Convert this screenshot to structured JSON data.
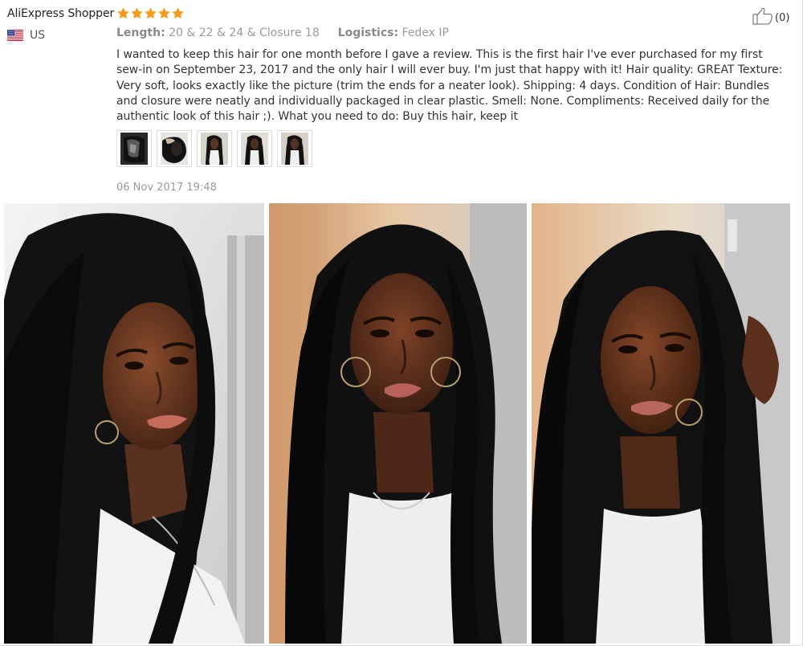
{
  "reviewer": {
    "name": "AliExpress Shopper",
    "country_code": "US",
    "flag_icon": "us-flag-icon"
  },
  "rating": {
    "stars": 5,
    "max": 5,
    "color": "#f49b1d"
  },
  "attributes": {
    "length_label": "Length:",
    "length_value": "20 & 22 & 24 & Closure 18",
    "logistics_label": "Logistics:",
    "logistics_value": "Fedex IP"
  },
  "body": "I wanted to keep this hair for one month before I gave a review. This is the first hair I've ever purchased for my first sew-in on September 23, 2017 and the only hair I will ever buy. I'm just that happy with it! Hair quality: GREAT Texture: Very soft, looks exactly like the picture (trim the ends for a neater look). Shipping: 4 days. Condition of Hair: Bundles and closure were neatly and individually packaged in clear plastic. Smell: None. Compliments: Received daily for the authentic look of this hair ;). What you need to do: Buy this hair, keep it",
  "thumbnails": [
    {
      "name": "review-thumbnail-1",
      "content": "hair-bundle-photo"
    },
    {
      "name": "review-thumbnail-2",
      "content": "hair-closure-photo"
    },
    {
      "name": "review-thumbnail-3",
      "content": "wearer-photo"
    },
    {
      "name": "review-thumbnail-4",
      "content": "wearer-photo"
    },
    {
      "name": "review-thumbnail-5",
      "content": "wearer-photo"
    }
  ],
  "date": "06 Nov 2017 19:48",
  "helpful": {
    "icon": "thumbs-up-icon",
    "count_text": "(0)"
  },
  "photos": [
    {
      "name": "review-photo-1",
      "content": "wearer-photo"
    },
    {
      "name": "review-photo-2",
      "content": "wearer-photo"
    },
    {
      "name": "review-photo-3",
      "content": "wearer-photo"
    }
  ],
  "colors": {
    "star": "#f49b1d",
    "meta_text": "#999999",
    "body_text": "#333333"
  }
}
